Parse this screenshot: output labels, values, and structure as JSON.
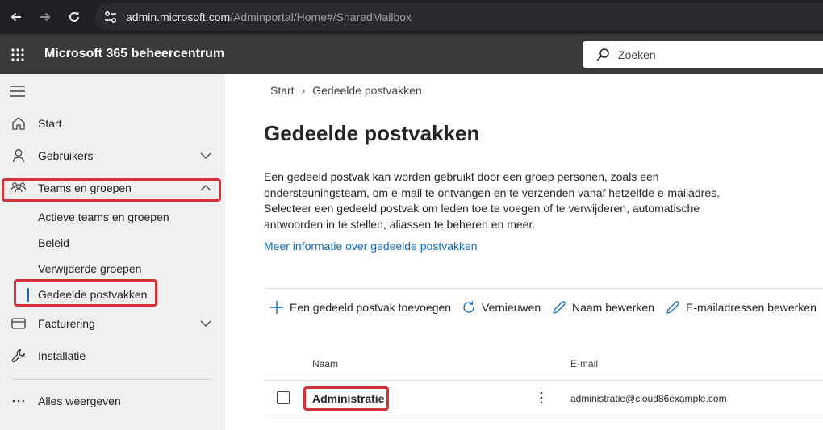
{
  "browser": {
    "url_host": "admin.microsoft.com",
    "url_path": "/Adminportal/Home#/SharedMailbox"
  },
  "header": {
    "app_title": "Microsoft 365 beheercentrum",
    "search_placeholder": "Zoeken"
  },
  "sidebar": {
    "items": [
      {
        "label": "Start",
        "icon": "home-icon"
      },
      {
        "label": "Gebruikers",
        "icon": "person-icon"
      },
      {
        "label": "Teams en groepen",
        "icon": "people-team-icon"
      },
      {
        "label": "Facturering",
        "icon": "billing-icon"
      },
      {
        "label": "Installatie",
        "icon": "wrench-icon"
      },
      {
        "label": "Alles weergeven",
        "icon": "more-horizontal-icon"
      }
    ],
    "sub_items": [
      {
        "label": "Actieve teams en groepen"
      },
      {
        "label": "Beleid"
      },
      {
        "label": "Verwijderde groepen"
      },
      {
        "label": "Gedeelde postvakken",
        "selected": true
      }
    ]
  },
  "breadcrumb": {
    "root": "Start",
    "current": "Gedeelde postvakken"
  },
  "main": {
    "title": "Gedeelde postvakken",
    "description": "Een gedeeld postvak kan worden gebruikt door een groep personen, zoals een ondersteuningsteam, om e-mail te ontvangen en te verzenden vanaf hetzelfde e-mailadres. Selecteer een gedeeld postvak om leden toe te voegen of te verwijderen, automatische antwoorden in te stellen, aliassen te beheren en meer.",
    "more_link": "Meer informatie over gedeelde postvakken"
  },
  "commands": {
    "add": "Een gedeeld postvak toevoegen",
    "refresh": "Vernieuwen",
    "rename": "Naam bewerken",
    "edit_email": "E-mailadressen bewerken"
  },
  "table": {
    "columns": {
      "name": "Naam",
      "email": "E-mail"
    },
    "rows": [
      {
        "name": "Administratie",
        "email": "administratie@cloud86example.com"
      }
    ]
  },
  "colors": {
    "accent": "#0f6cbd",
    "highlight": "#d13438",
    "header_bg": "#3b3a39",
    "sidebar_bg": "#f0f0f0"
  }
}
